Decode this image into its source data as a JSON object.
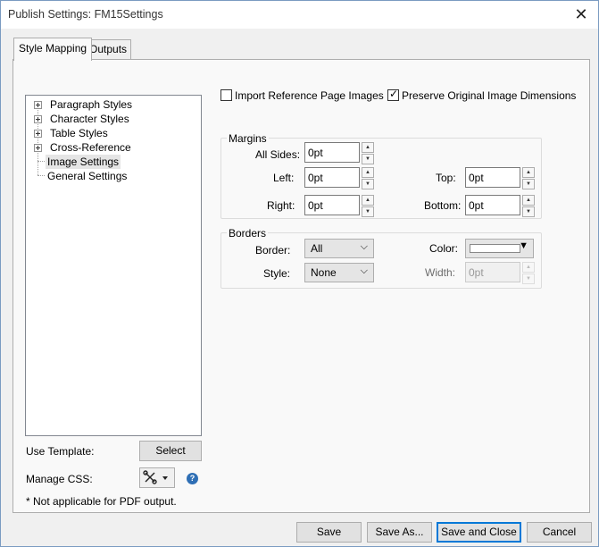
{
  "window": {
    "title": "Publish Settings: FM15Settings"
  },
  "tabs": [
    {
      "label": "Style Mapping",
      "active": true
    },
    {
      "label": "Outputs",
      "active": false
    }
  ],
  "tree": {
    "items": [
      {
        "label": "Paragraph Styles",
        "expandable": true,
        "selected": false
      },
      {
        "label": "Character Styles",
        "expandable": true,
        "selected": false
      },
      {
        "label": "Table Styles",
        "expandable": true,
        "selected": false
      },
      {
        "label": "Cross-Reference",
        "expandable": true,
        "selected": false
      },
      {
        "label": "Image Settings",
        "expandable": false,
        "selected": true
      },
      {
        "label": "General Settings",
        "expandable": false,
        "selected": false
      }
    ]
  },
  "left_bottom": {
    "use_template_label": "Use Template:",
    "select_button": "Select",
    "manage_css_label": "Manage CSS:",
    "note": "* Not applicable for PDF output."
  },
  "options": {
    "import_reference_label": "Import Reference Page Images",
    "import_reference_checked": false,
    "preserve_dimensions_label": "Preserve Original Image Dimensions",
    "preserve_dimensions_checked": true
  },
  "margins": {
    "title": "Margins",
    "all_sides_label": "All Sides:",
    "all_sides_value": "0pt",
    "left_label": "Left:",
    "left_value": "0pt",
    "top_label": "Top:",
    "top_value": "0pt",
    "right_label": "Right:",
    "right_value": "0pt",
    "bottom_label": "Bottom:",
    "bottom_value": "0pt"
  },
  "borders": {
    "title": "Borders",
    "border_label": "Border:",
    "border_value": "All",
    "color_label": "Color:",
    "color_value": "#ffffff",
    "style_label": "Style:",
    "style_value": "None",
    "width_label": "Width:",
    "width_value": "0pt"
  },
  "footer": {
    "save": "Save",
    "save_as": "Save As...",
    "save_and_close": "Save and Close",
    "cancel": "Cancel"
  }
}
